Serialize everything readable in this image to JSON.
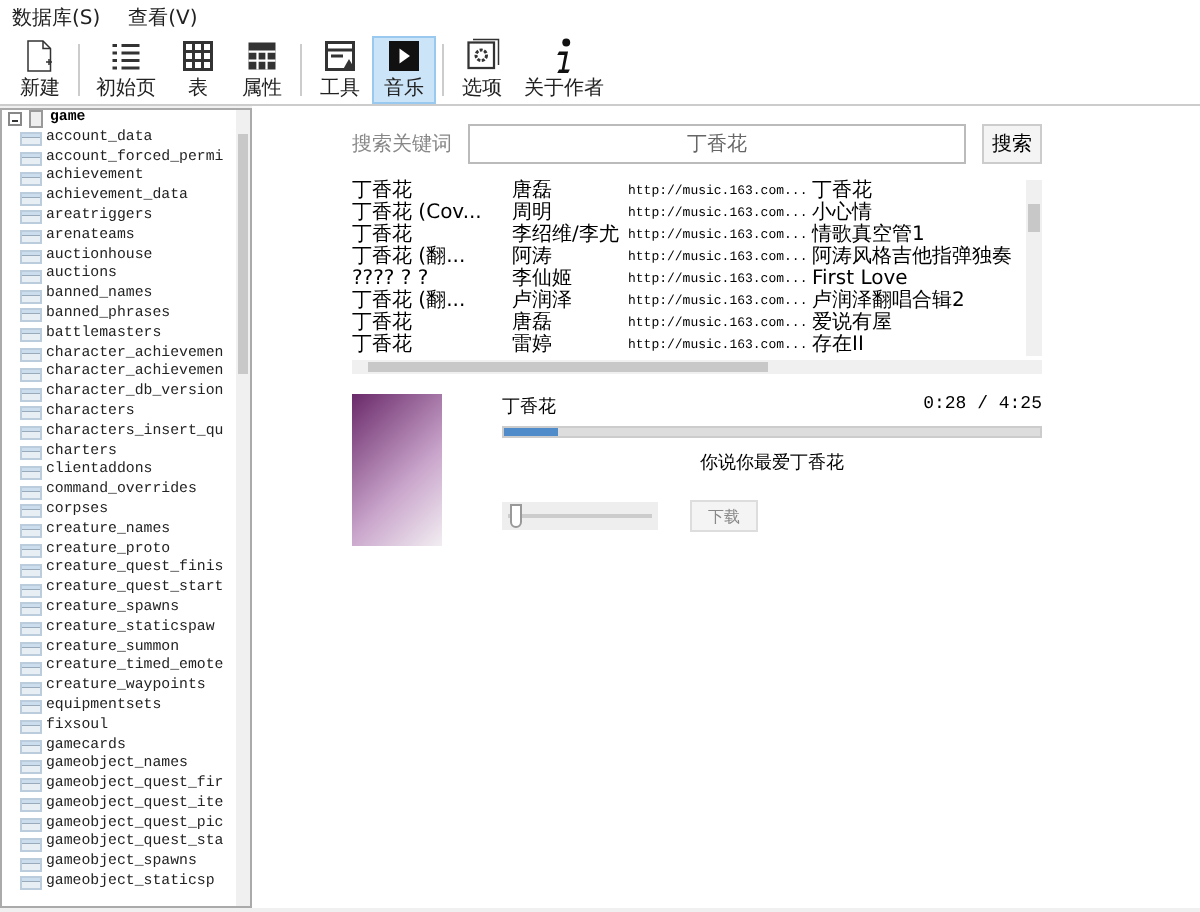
{
  "menu": [
    {
      "label": "数据库(S)"
    },
    {
      "label": "查看(V)"
    }
  ],
  "toolbar": [
    {
      "kind": "new",
      "label": "新建",
      "selected": false
    },
    {
      "kind": "home",
      "label": "初始页",
      "selected": false
    },
    {
      "kind": "table",
      "label": "表",
      "selected": false
    },
    {
      "kind": "properties",
      "label": "属性",
      "selected": false
    },
    {
      "kind": "tools",
      "label": "工具",
      "selected": false
    },
    {
      "kind": "music",
      "label": "音乐",
      "selected": true
    },
    {
      "kind": "options",
      "label": "选项",
      "selected": false
    },
    {
      "kind": "about",
      "label": "关于作者",
      "selected": false
    }
  ],
  "tree": {
    "label": "game",
    "expanded": true,
    "children": [
      {
        "label": "account_data"
      },
      {
        "label": "account_forced_permi"
      },
      {
        "label": "achievement"
      },
      {
        "label": "achievement_data"
      },
      {
        "label": "areatriggers"
      },
      {
        "label": "arenateams"
      },
      {
        "label": "auctionhouse"
      },
      {
        "label": "auctions"
      },
      {
        "label": "banned_names"
      },
      {
        "label": "banned_phrases"
      },
      {
        "label": "battlemasters"
      },
      {
        "label": "character_achievemen"
      },
      {
        "label": "character_achievemen"
      },
      {
        "label": "character_db_version"
      },
      {
        "label": "characters"
      },
      {
        "label": "characters_insert_qu"
      },
      {
        "label": "charters"
      },
      {
        "label": "clientaddons"
      },
      {
        "label": "command_overrides"
      },
      {
        "label": "corpses"
      },
      {
        "label": "creature_names"
      },
      {
        "label": "creature_proto"
      },
      {
        "label": "creature_quest_finis"
      },
      {
        "label": "creature_quest_start"
      },
      {
        "label": "creature_spawns"
      },
      {
        "label": "creature_staticspaw"
      },
      {
        "label": "creature_summon"
      },
      {
        "label": "creature_timed_emote"
      },
      {
        "label": "creature_waypoints"
      },
      {
        "label": "equipmentsets"
      },
      {
        "label": "fixsoul"
      },
      {
        "label": "gamecards"
      },
      {
        "label": "gameobject_names"
      },
      {
        "label": "gameobject_quest_fir"
      },
      {
        "label": "gameobject_quest_ite"
      },
      {
        "label": "gameobject_quest_pic"
      },
      {
        "label": "gameobject_quest_sta"
      },
      {
        "label": "gameobject_spawns"
      },
      {
        "label": "gameobject_staticsp"
      }
    ]
  },
  "search": {
    "label": "搜索关键词",
    "value": "丁香花",
    "button": "搜索"
  },
  "songs": [
    {
      "title": "丁香花",
      "artist": "唐磊",
      "url": "http://music.163.com...",
      "album": "丁香花"
    },
    {
      "title": "丁香花 (Cov...",
      "artist": "周明",
      "url": "http://music.163.com...",
      "album": "小心情"
    },
    {
      "title": "丁香花",
      "artist": "李绍维/李尤",
      "url": "http://music.163.com...",
      "album": "情歌真空管1"
    },
    {
      "title": "丁香花 (翻...",
      "artist": "阿涛",
      "url": "http://music.163.com...",
      "album": "阿涛风格吉他指弹独奏"
    },
    {
      "title": "???? ? ?",
      "artist": "李仙姬",
      "url": "http://music.163.com...",
      "album": "First Love"
    },
    {
      "title": "丁香花 (翻...",
      "artist": "卢润泽",
      "url": "http://music.163.com...",
      "album": "卢润泽翻唱合辑2"
    },
    {
      "title": "丁香花",
      "artist": "唐磊",
      "url": "http://music.163.com...",
      "album": "爱说有屋"
    },
    {
      "title": "丁香花",
      "artist": "雷婷",
      "url": "http://music.163.com...",
      "album": "存在II"
    }
  ],
  "player": {
    "title": "丁香花",
    "time": "0:28 / 4:25",
    "level": 0.1,
    "lyric": "你说你最爱丁香花",
    "volume": {
      "level": 0.05
    },
    "download": "下载"
  }
}
